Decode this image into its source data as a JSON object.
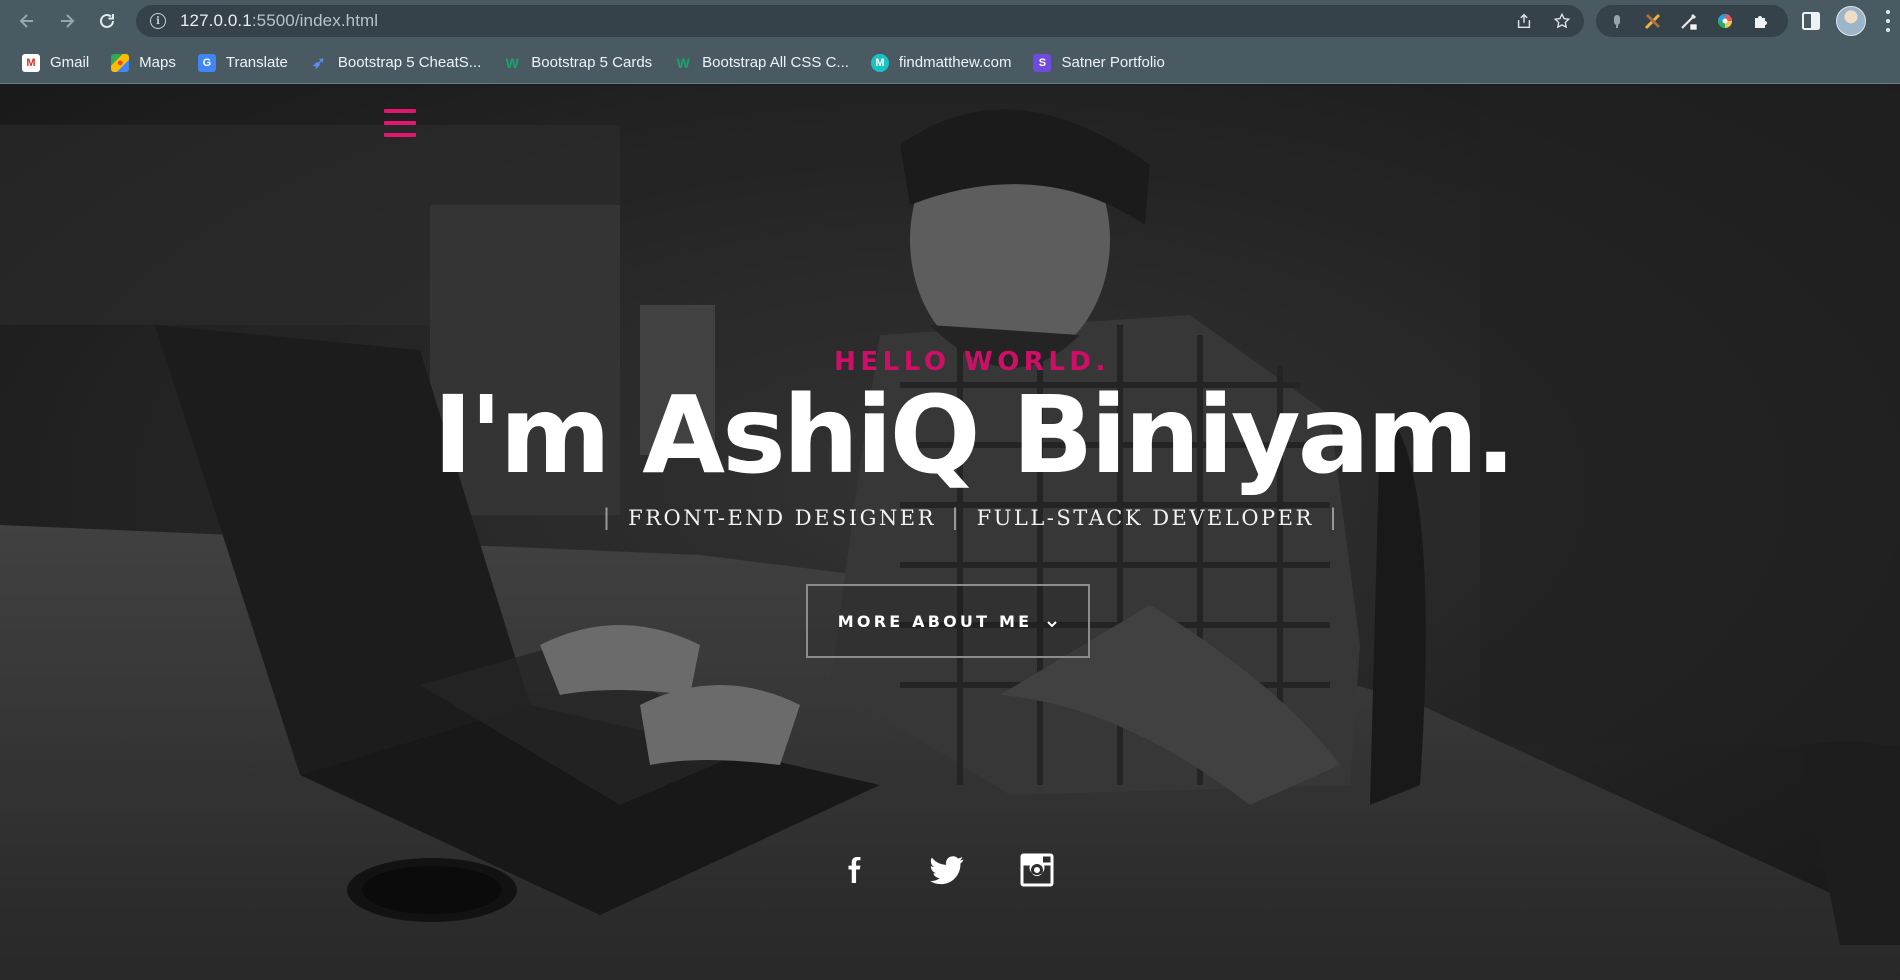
{
  "browser": {
    "url_host": "127.0.0.1",
    "url_path": ":5500/index.html",
    "bookmarks": [
      {
        "label": "Gmail",
        "icon": "gmail-icon"
      },
      {
        "label": "Maps",
        "icon": "maps-icon"
      },
      {
        "label": "Translate",
        "icon": "translate-icon"
      },
      {
        "label": "Bootstrap 5 CheatS...",
        "icon": "bootstrap-cheatsheet-icon"
      },
      {
        "label": "Bootstrap 5 Cards",
        "icon": "bootstrap-cards-icon"
      },
      {
        "label": "Bootstrap All CSS C...",
        "icon": "bootstrap-css-icon"
      },
      {
        "label": "findmatthew.com",
        "icon": "findmatthew-icon"
      },
      {
        "label": "Satner Portfolio",
        "icon": "satner-icon"
      }
    ]
  },
  "hero": {
    "greeting": "HELLO WORLD.",
    "name": "I'm AshiQ Biniyam.",
    "separator": "|",
    "roles": [
      "FRONT-END DESIGNER",
      "FULL-STACK DEVELOPER"
    ],
    "cta_label": "MORE ABOUT ME"
  },
  "social": [
    {
      "name": "facebook-icon"
    },
    {
      "name": "twitter-icon"
    },
    {
      "name": "instagram-icon"
    }
  ],
  "colors": {
    "accent": "#cf0f67",
    "browser_bg": "#4a5a63",
    "omnibox_bg": "#35424a"
  }
}
